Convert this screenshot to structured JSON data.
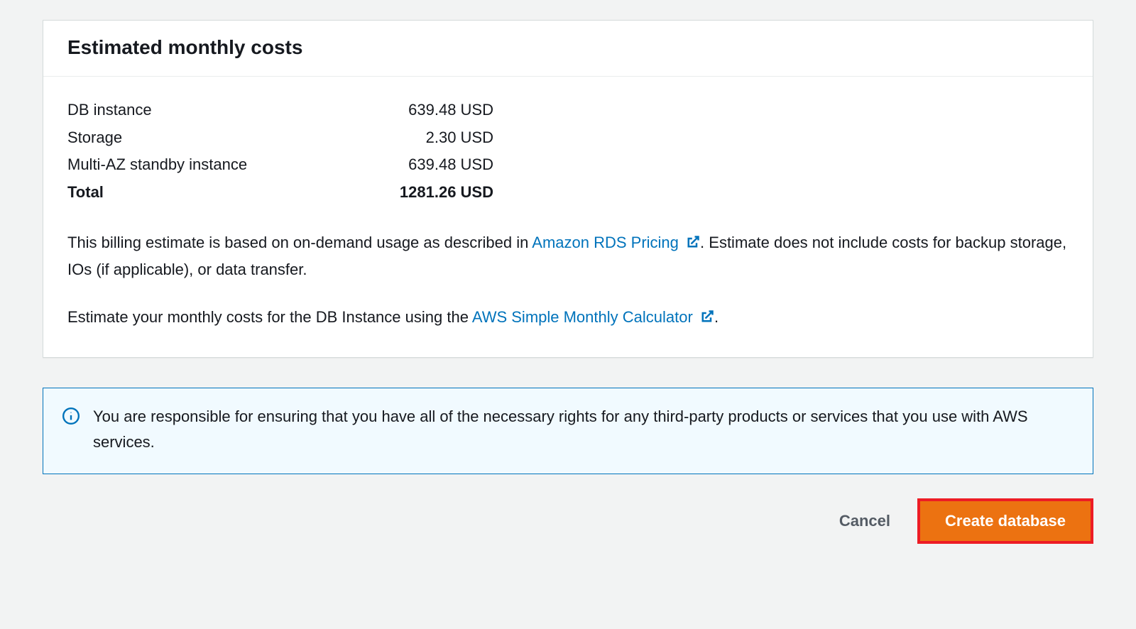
{
  "panel": {
    "title": "Estimated monthly costs",
    "costs": {
      "rows": [
        {
          "label": "DB instance",
          "value": "639.48 USD"
        },
        {
          "label": "Storage",
          "value": "2.30 USD"
        },
        {
          "label": "Multi-AZ standby instance",
          "value": "639.48 USD"
        }
      ],
      "total_label": "Total",
      "total_value": "1281.26 USD"
    },
    "desc1_pre": "This billing estimate is based on on-demand usage as described in ",
    "desc1_link": "Amazon RDS Pricing",
    "desc1_post": ". Estimate does not include costs for backup storage, IOs (if applicable), or data transfer.",
    "desc2_pre": "Estimate your monthly costs for the DB Instance using the ",
    "desc2_link": "AWS Simple Monthly Calculator",
    "desc2_post": "."
  },
  "alert": {
    "text": "You are responsible for ensuring that you have all of the necessary rights for any third-party products or services that you use with AWS services."
  },
  "actions": {
    "cancel": "Cancel",
    "create": "Create database"
  },
  "colors": {
    "link": "#0073bb",
    "primary": "#ec7211",
    "highlight_border": "#ed1c24"
  }
}
